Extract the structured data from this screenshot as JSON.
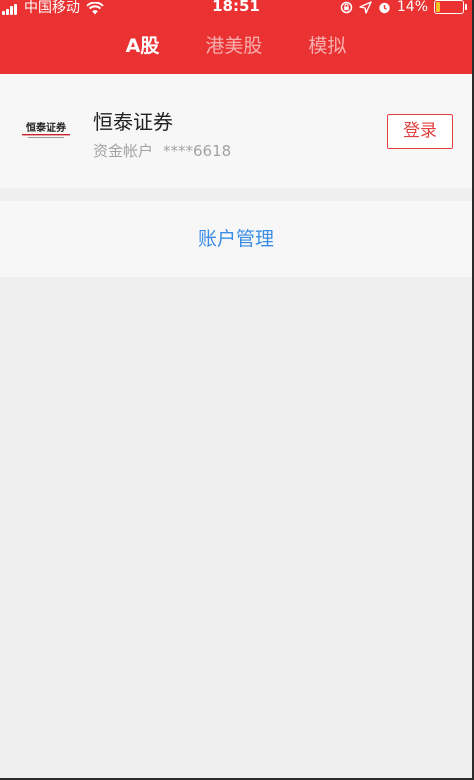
{
  "status_bar": {
    "carrier": "中国移动",
    "time": "18:51",
    "battery": "14%",
    "battery_level": 0.14
  },
  "tabs": [
    {
      "label": "A股",
      "active": true
    },
    {
      "label": "港美股",
      "active": false
    },
    {
      "label": "模拟",
      "active": false
    }
  ],
  "broker": {
    "name": "恒泰证券",
    "logo_text": "恒泰证券",
    "account_label": "资金帐户",
    "account_masked": "****6618",
    "login_label": "登录"
  },
  "manage": {
    "label": "账户管理"
  },
  "colors": {
    "header_red": "#ea3232",
    "login_red": "#e04040",
    "link_blue": "#3a8ee6",
    "battery_yellow": "#f6c325"
  }
}
